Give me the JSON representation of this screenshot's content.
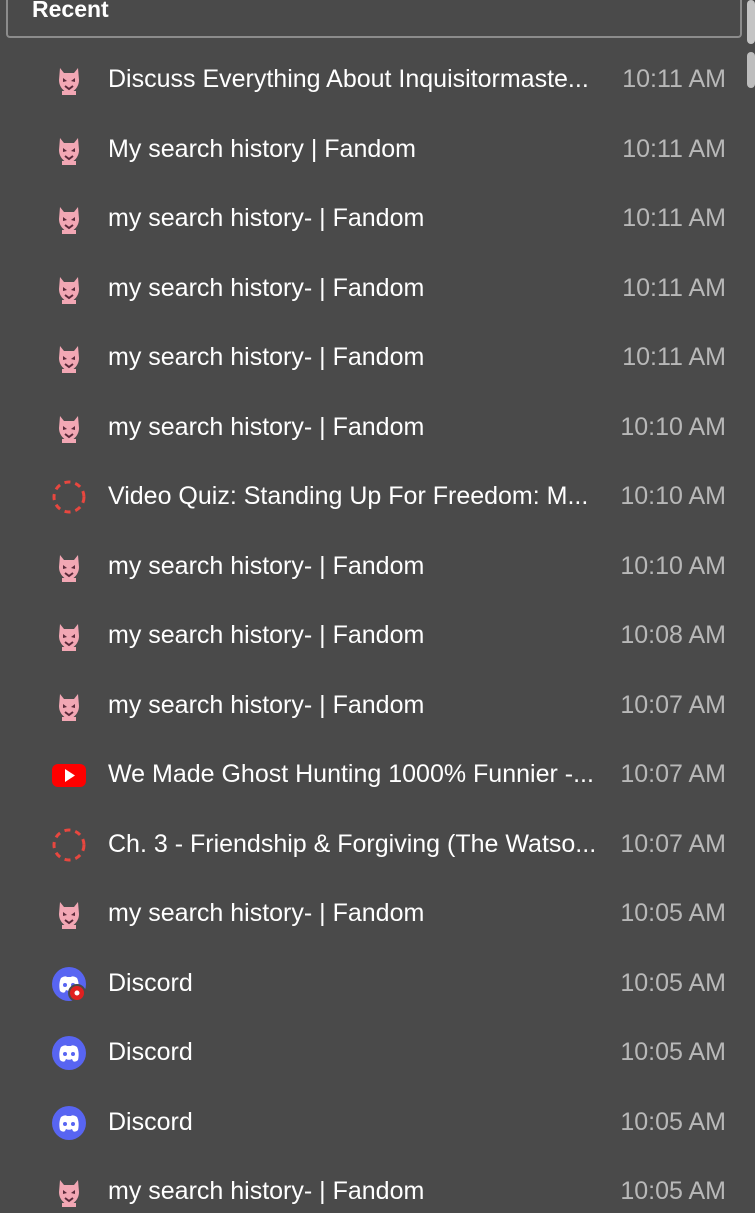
{
  "header": {
    "title": "Recent"
  },
  "items": [
    {
      "title": "Discuss Everything About Inquisitormaste...",
      "time": "10:11 AM",
      "icon": "fandom-icon"
    },
    {
      "title": "My search history | Fandom",
      "time": "10:11 AM",
      "icon": "fandom-icon"
    },
    {
      "title": "my search history- | Fandom",
      "time": "10:11 AM",
      "icon": "fandom-icon"
    },
    {
      "title": "my search history- | Fandom",
      "time": "10:11 AM",
      "icon": "fandom-icon"
    },
    {
      "title": "my search history- | Fandom",
      "time": "10:11 AM",
      "icon": "fandom-icon"
    },
    {
      "title": "my search history- | Fandom",
      "time": "10:10 AM",
      "icon": "fandom-icon"
    },
    {
      "title": "Video Quiz: Standing Up For Freedom: M...",
      "time": "10:10 AM",
      "icon": "loading-circle-icon"
    },
    {
      "title": "my search history- | Fandom",
      "time": "10:10 AM",
      "icon": "fandom-icon"
    },
    {
      "title": "my search history- | Fandom",
      "time": "10:08 AM",
      "icon": "fandom-icon"
    },
    {
      "title": "my search history- | Fandom",
      "time": "10:07 AM",
      "icon": "fandom-icon"
    },
    {
      "title": "We Made Ghost Hunting 1000% Funnier -...",
      "time": "10:07 AM",
      "icon": "youtube-icon"
    },
    {
      "title": "Ch. 3 - Friendship & Forgiving (The Watso...",
      "time": "10:07 AM",
      "icon": "loading-circle-icon"
    },
    {
      "title": "my search history- | Fandom",
      "time": "10:05 AM",
      "icon": "fandom-icon"
    },
    {
      "title": "Discord",
      "time": "10:05 AM",
      "icon": "discord-notification-icon"
    },
    {
      "title": "Discord",
      "time": "10:05 AM",
      "icon": "discord-icon"
    },
    {
      "title": "Discord",
      "time": "10:05 AM",
      "icon": "discord-icon"
    },
    {
      "title": "my search history- | Fandom",
      "time": "10:05 AM",
      "icon": "fandom-icon"
    }
  ],
  "colors": {
    "background": "#4a4a4a",
    "fandom": "#f2a7b4",
    "youtube": "#ff0000",
    "discord": "#5865f2",
    "loading": "#e8473f",
    "time_text": "#b8b8b8"
  }
}
